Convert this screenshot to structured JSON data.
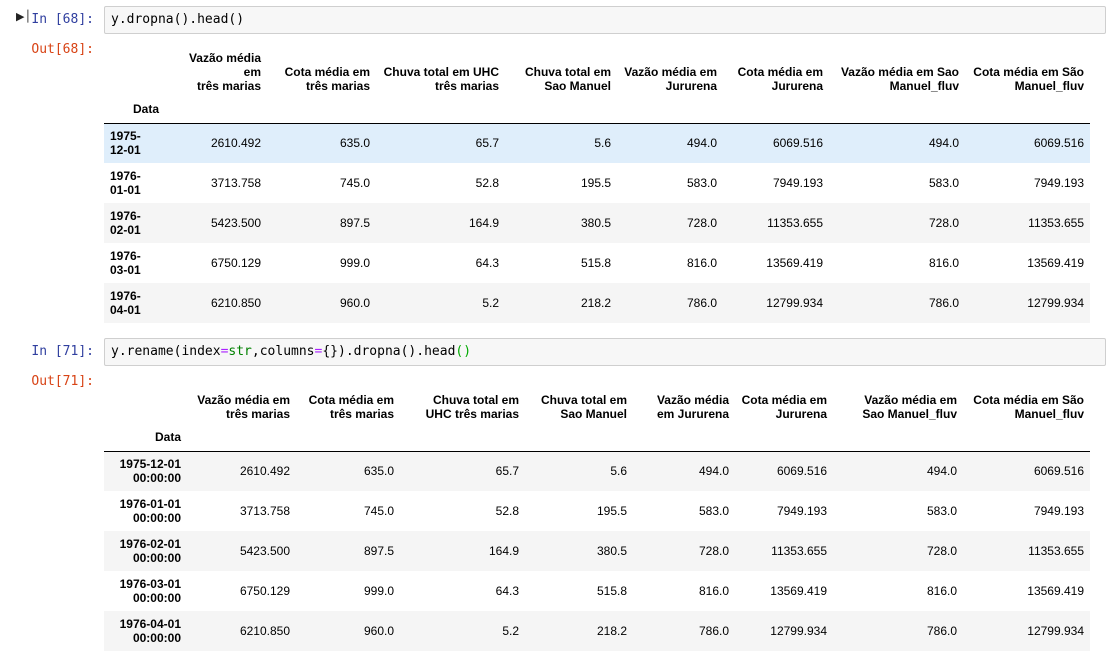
{
  "cells": [
    {
      "in_prompt": "In [68]:",
      "code": [
        {
          "t": "y.dropna().head()",
          "c": ""
        }
      ],
      "out_prompt": "Out[68]:",
      "index_name": "Data",
      "columns": [
        [
          "Vazão média em",
          "três marias"
        ],
        [
          "Cota média em",
          "três marias"
        ],
        [
          "Chuva total em UHC",
          "três marias"
        ],
        [
          "Chuva total em",
          "Sao Manuel"
        ],
        [
          "Vazão média em",
          "Jururena"
        ],
        [
          "Cota média em",
          "Jururena"
        ],
        [
          "Vazão média em Sao",
          "Manuel_fluv"
        ],
        [
          "Cota média em São",
          "Manuel_fluv"
        ]
      ],
      "rows": [
        {
          "index": [
            "1975-",
            "12-01"
          ],
          "values": [
            "2610.492",
            "635.0",
            "65.7",
            "5.6",
            "494.0",
            "6069.516",
            "494.0",
            "6069.516"
          ]
        },
        {
          "index": [
            "1976-",
            "01-01"
          ],
          "values": [
            "3713.758",
            "745.0",
            "52.8",
            "195.5",
            "583.0",
            "7949.193",
            "583.0",
            "7949.193"
          ]
        },
        {
          "index": [
            "1976-",
            "02-01"
          ],
          "values": [
            "5423.500",
            "897.5",
            "164.9",
            "380.5",
            "728.0",
            "11353.655",
            "728.0",
            "11353.655"
          ]
        },
        {
          "index": [
            "1976-",
            "03-01"
          ],
          "values": [
            "6750.129",
            "999.0",
            "64.3",
            "515.8",
            "816.0",
            "13569.419",
            "816.0",
            "13569.419"
          ]
        },
        {
          "index": [
            "1976-",
            "04-01"
          ],
          "values": [
            "6210.850",
            "960.0",
            "5.2",
            "218.2",
            "786.0",
            "12799.934",
            "786.0",
            "12799.934"
          ]
        }
      ]
    },
    {
      "in_prompt": "In [71]:",
      "code": [
        {
          "t": "y.rename(index",
          "c": ""
        },
        {
          "t": "=",
          "c": "tok-op"
        },
        {
          "t": "str",
          "c": "tok-kw"
        },
        {
          "t": ",columns",
          "c": ""
        },
        {
          "t": "=",
          "c": "tok-op"
        },
        {
          "t": "{}).dropna().head",
          "c": ""
        },
        {
          "t": "()",
          "c": "tok-br"
        }
      ],
      "out_prompt": "Out[71]:",
      "index_name": "Data",
      "columns": [
        [
          "Vazão média em",
          "três marias"
        ],
        [
          "Cota média em",
          "três marias"
        ],
        [
          "Chuva total em",
          "UHC três marias"
        ],
        [
          "Chuva total em",
          "Sao Manuel"
        ],
        [
          "Vazão média",
          "em Jururena"
        ],
        [
          "Cota média em",
          "Jururena"
        ],
        [
          "Vazão média em",
          "Sao Manuel_fluv"
        ],
        [
          "Cota média em São",
          "Manuel_fluv"
        ]
      ],
      "rows": [
        {
          "index": [
            "1975-12-01",
            "00:00:00"
          ],
          "values": [
            "2610.492",
            "635.0",
            "65.7",
            "5.6",
            "494.0",
            "6069.516",
            "494.0",
            "6069.516"
          ]
        },
        {
          "index": [
            "1976-01-01",
            "00:00:00"
          ],
          "values": [
            "3713.758",
            "745.0",
            "52.8",
            "195.5",
            "583.0",
            "7949.193",
            "583.0",
            "7949.193"
          ]
        },
        {
          "index": [
            "1976-02-01",
            "00:00:00"
          ],
          "values": [
            "5423.500",
            "897.5",
            "164.9",
            "380.5",
            "728.0",
            "11353.655",
            "728.0",
            "11353.655"
          ]
        },
        {
          "index": [
            "1976-03-01",
            "00:00:00"
          ],
          "values": [
            "6750.129",
            "999.0",
            "64.3",
            "515.8",
            "816.0",
            "13569.419",
            "816.0",
            "13569.419"
          ]
        },
        {
          "index": [
            "1976-04-01",
            "00:00:00"
          ],
          "values": [
            "6210.850",
            "960.0",
            "5.2",
            "218.2",
            "786.0",
            "12799.934",
            "786.0",
            "12799.934"
          ]
        }
      ]
    }
  ],
  "icons": {
    "run_indicator": "step-marker-icon"
  },
  "highlight": {
    "cell": 0,
    "row": 0,
    "color": "#dfeefb"
  },
  "colors": {
    "in_prompt": "#303f9f",
    "out_prompt": "#d84315",
    "code_bg": "#f7f7f7",
    "stripe": "#f5f5f5"
  }
}
